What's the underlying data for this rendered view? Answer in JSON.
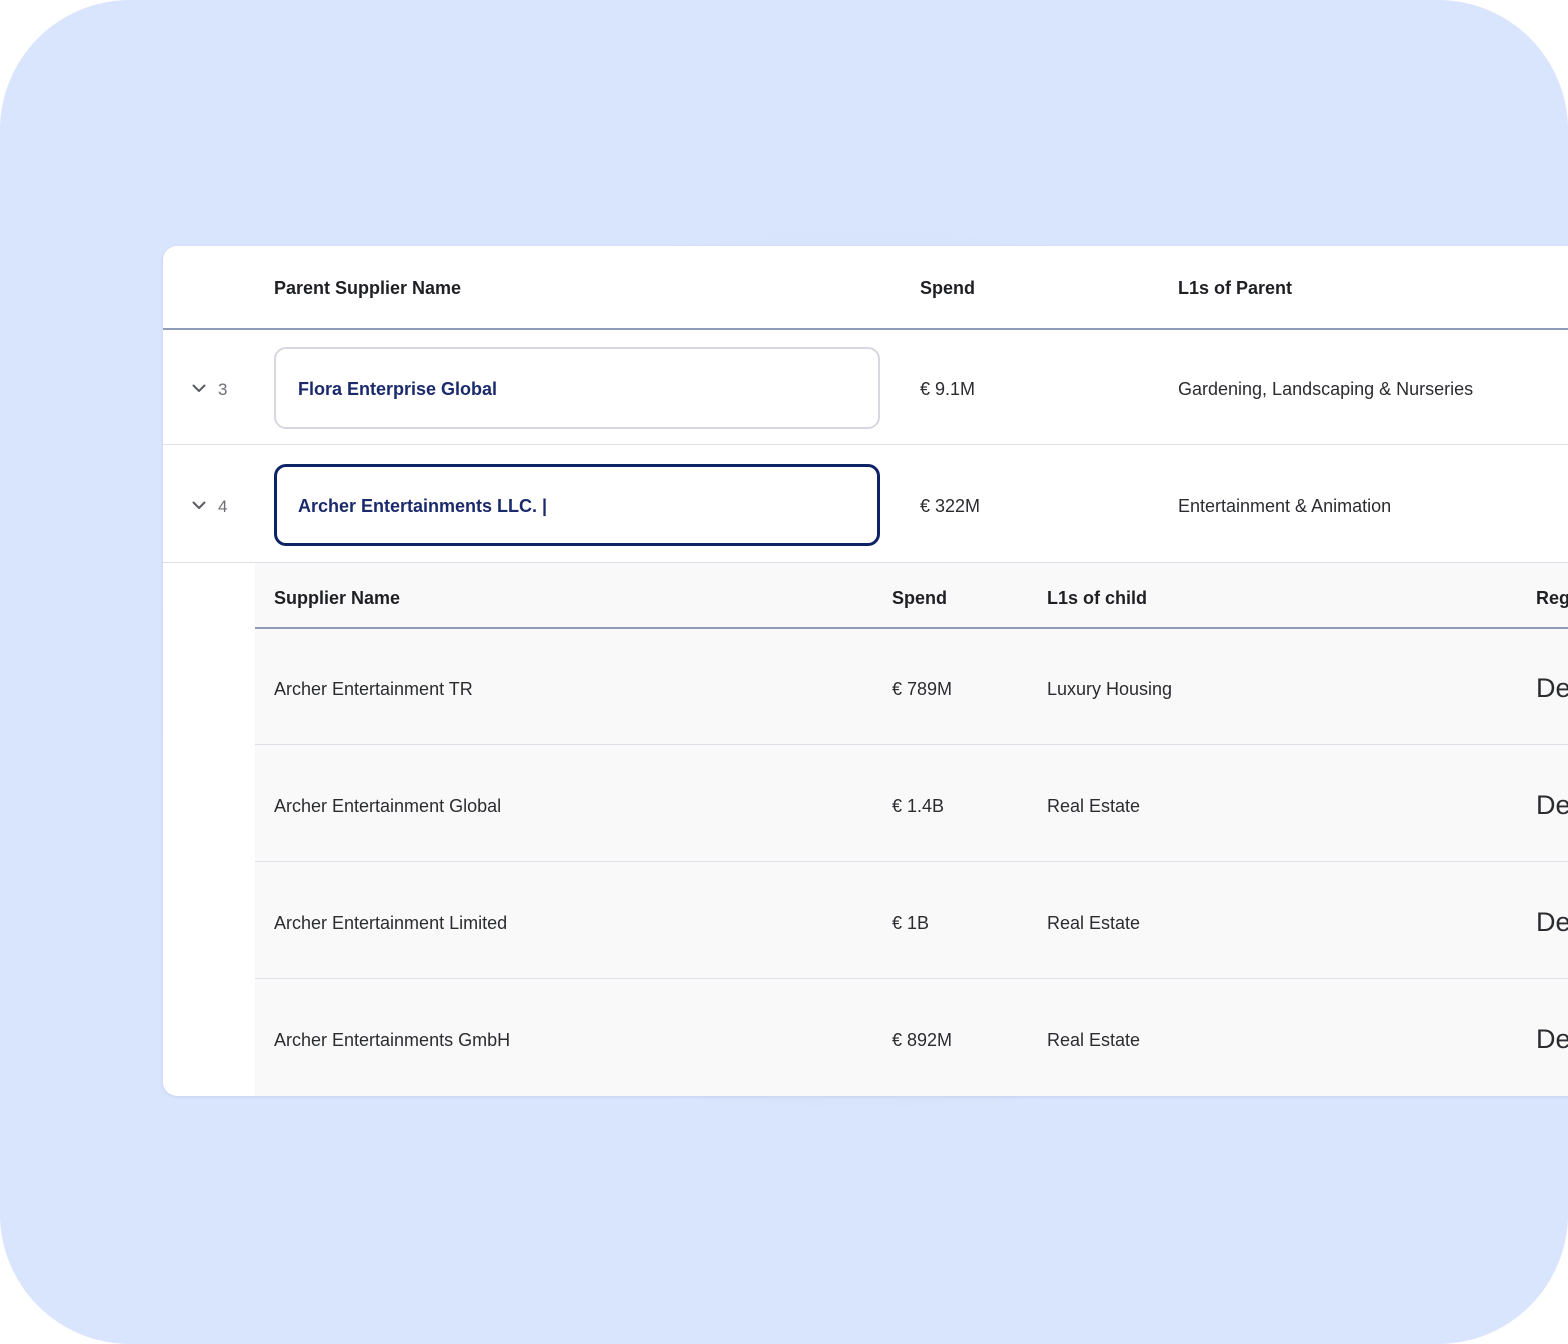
{
  "parent_table": {
    "columns": [
      "Parent Supplier Name",
      "Spend",
      "L1s of Parent"
    ],
    "rows": [
      {
        "index": "3",
        "name": "Flora Enterprise Global",
        "spend": "€ 9.1M",
        "l1": "Gardening, Landscaping & Nurseries",
        "icon": "chevron-down-icon"
      },
      {
        "index": "4",
        "name": "Archer Entertainments LLC. |",
        "spend": "€ 322M",
        "l1": "Entertainment & Animation",
        "icon": "chevron-down-icon",
        "editing": true
      }
    ]
  },
  "child_table": {
    "columns": [
      "Supplier Name",
      "Spend",
      "L1s of child",
      "Reg"
    ],
    "rows": [
      {
        "name": "Archer Entertainment TR",
        "spend": "€ 789M",
        "l1": "Luxury Housing",
        "reg": "De"
      },
      {
        "name": "Archer Entertainment Global",
        "spend": "€ 1.4B",
        "l1": "Real Estate",
        "reg": "De"
      },
      {
        "name": "Archer Entertainment Limited",
        "spend": "€ 1B",
        "l1": "Real Estate",
        "reg": "De"
      },
      {
        "name": "Archer Entertainments GmbH",
        "spend": "€ 892M",
        "l1": "Real Estate",
        "reg": "De"
      }
    ]
  },
  "colors": {
    "background": "#d9e4fd",
    "accent": "#0d2366",
    "link_text": "#1a2a6c",
    "subtable_bg": "#f9f9f9"
  }
}
